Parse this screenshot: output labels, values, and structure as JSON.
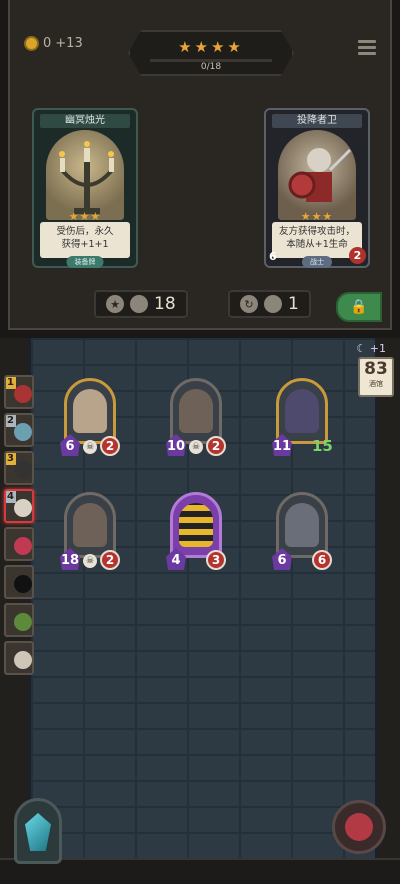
{
  "header": {
    "gold": "0",
    "gold_gain": "+13",
    "stars": "★★★★",
    "progress": "0/18",
    "progress_fraction": 0
  },
  "cards": [
    {
      "title": "幽冥烛光",
      "stars": "★★★",
      "desc_line1": "受伤后，永久",
      "desc_line2": "获得+1+1",
      "tag": "装备牌"
    },
    {
      "title": "投降者卫",
      "stars": "★★★",
      "desc_line1": "友方获得攻击时，",
      "desc_line2": "本随从+1生命",
      "tag": "战士",
      "attack": "6",
      "health": "2"
    }
  ],
  "stats": {
    "star_count": "18",
    "refresh_count": "1"
  },
  "shop": {
    "moon_gain": "+1",
    "tier_value": "83",
    "tier_label": "酒馆"
  },
  "queue": [
    {
      "num": "1"
    },
    {
      "num": "2"
    },
    {
      "num": "3"
    },
    {
      "num": "4"
    },
    {
      "num": ""
    },
    {
      "num": ""
    },
    {
      "num": ""
    },
    {
      "num": ""
    }
  ],
  "board_units": [
    {
      "atk": "6",
      "hp": "2",
      "frame": "gold"
    },
    {
      "atk": "10",
      "hp": "2",
      "frame": "gray"
    },
    {
      "atk": "11",
      "hp": "15",
      "frame": "gold"
    },
    {
      "atk": "18",
      "hp": "2",
      "frame": "gray"
    },
    {
      "atk": "4",
      "hp": "3",
      "frame": "purple"
    },
    {
      "atk": "6",
      "hp": "6",
      "frame": "gray"
    }
  ],
  "icons": {
    "coin": "coin-icon",
    "menu": "menu-icon",
    "star": "star-icon",
    "refresh": "refresh-icon",
    "lock": "lock-icon",
    "moon": "moon-icon",
    "skull": "skull-icon"
  },
  "colors": {
    "accent_star": "#e7a53a",
    "health": "#b43430",
    "attack": "#6a3aa0",
    "lock": "#3e8a4c"
  }
}
